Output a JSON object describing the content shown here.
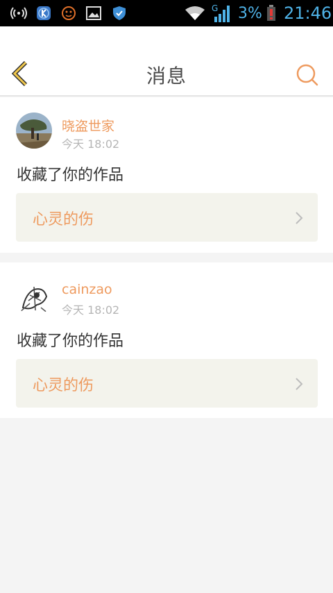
{
  "status_bar": {
    "battery_percent": "3%",
    "time": "21:46",
    "network_type": "G",
    "icons": [
      "wifi-hotspot-icon",
      "k-app-icon",
      "face-app-icon",
      "gallery-icon",
      "shield-icon",
      "wifi-icon",
      "signal-icon",
      "battery-icon"
    ]
  },
  "header": {
    "title": "消息",
    "back_icon": "back-chevron-icon",
    "search_icon": "search-icon"
  },
  "messages": [
    {
      "username": "晓盗世家",
      "time": "今天 18:02",
      "action": "收藏了你的作品",
      "work_title": "心灵的伤"
    },
    {
      "username": "cainzao",
      "time": "今天 18:02",
      "action": "收藏了你的作品",
      "work_title": "心灵的伤"
    }
  ],
  "colors": {
    "accent": "#ee9a5e",
    "status_text": "#4fb3e8",
    "back_icon": "#f2c94c"
  }
}
